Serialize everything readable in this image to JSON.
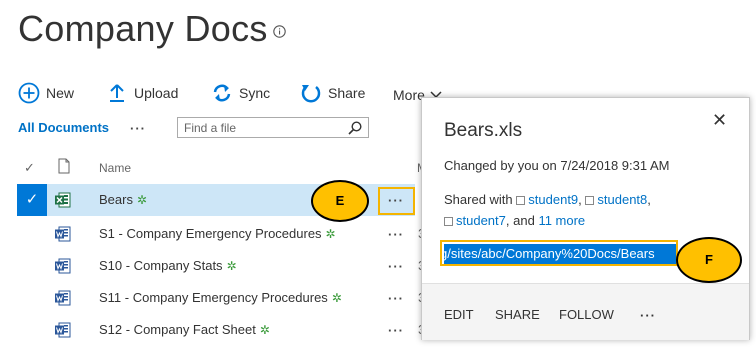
{
  "page": {
    "title": "Company Docs"
  },
  "toolbar": {
    "new": "New",
    "upload": "Upload",
    "sync": "Sync",
    "share": "Share",
    "more": "More"
  },
  "view": {
    "all_documents": "All Documents",
    "more_dots": "···",
    "search_placeholder": "Find a file"
  },
  "columns": {
    "check": "✓",
    "name": "Name",
    "partial_col": "M"
  },
  "files": [
    {
      "name": "Bears",
      "type": "excel",
      "selected": true,
      "dots": "···",
      "extra": ""
    },
    {
      "name": "S1 - Company Emergency Procedures",
      "type": "word",
      "selected": false,
      "dots": "···",
      "extra": "3"
    },
    {
      "name": "S10 - Company Stats",
      "type": "word",
      "selected": false,
      "dots": "···",
      "extra": "3"
    },
    {
      "name": "S11 - Company Emergency Procedures",
      "type": "word",
      "selected": false,
      "dots": "···",
      "extra": "3"
    },
    {
      "name": "S12 - Company Fact Sheet",
      "type": "word",
      "selected": false,
      "dots": "···",
      "extra": "3"
    }
  ],
  "new_marker": "✲",
  "callout": {
    "filename": "Bears.xls",
    "close": "✕",
    "changed": "Changed by you on 7/24/2018 9:31 AM",
    "shared_prefix": "Shared with",
    "shared_users": [
      "student9",
      "student8",
      "student7"
    ],
    "shared_and": "and",
    "shared_more": "11 more",
    "url": "g/sites/abc/Company%20Docs/Bears",
    "actions": {
      "edit": "EDIT",
      "share": "SHARE",
      "follow": "FOLLOW",
      "more": "···"
    }
  },
  "annotations": {
    "marker_e": "E",
    "marker_f": "F",
    "highlight_color": "#f4b400",
    "marker_color": "#ffc000"
  },
  "colors": {
    "accent": "#0078d7",
    "link": "#0072c6",
    "selected_row": "#cde6f7",
    "excel_green": "#1e7145",
    "word_blue": "#2b579a"
  }
}
